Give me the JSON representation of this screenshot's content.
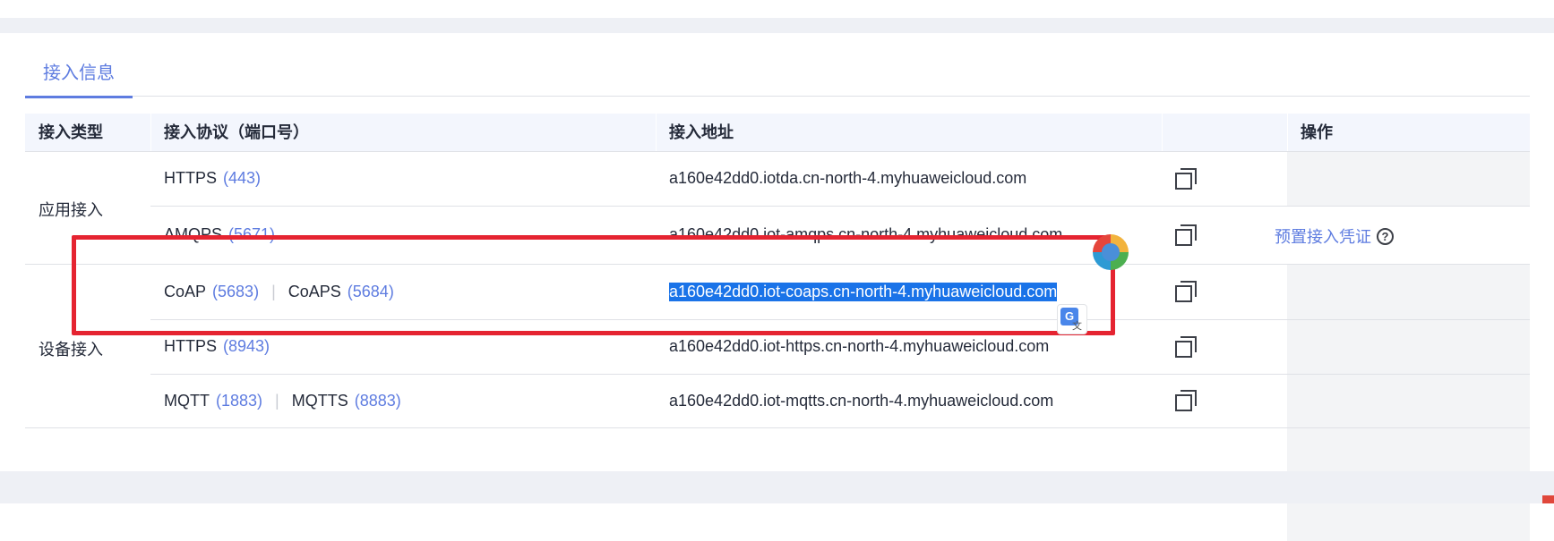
{
  "tabs": [
    {
      "label": "接入信息",
      "active": true
    }
  ],
  "table": {
    "headers": [
      "接入类型",
      "接入协议（端口号）",
      "接入地址",
      "",
      "操作"
    ],
    "groups": {
      "app": "应用接入",
      "device": "设备接入"
    },
    "rows": [
      {
        "protocols": [
          {
            "name": "HTTPS",
            "port": "(443)"
          }
        ],
        "address": "a160e42dd0.iotda.cn-north-4.myhuaweicloud.com"
      },
      {
        "protocols": [
          {
            "name": "AMQPS",
            "port": "(5671)"
          }
        ],
        "address": "a160e42dd0.iot-amqps.cn-north-4.myhuaweicloud.com"
      },
      {
        "protocols": [
          {
            "name": "CoAP",
            "port": "(5683)"
          },
          {
            "name": "CoAPS",
            "port": "(5684)"
          }
        ],
        "address": "a160e42dd0.iot-coaps.cn-north-4.myhuaweicloud.com",
        "selected": true
      },
      {
        "protocols": [
          {
            "name": "HTTPS",
            "port": "(8943)"
          }
        ],
        "address": "a160e42dd0.iot-https.cn-north-4.myhuaweicloud.com"
      },
      {
        "protocols": [
          {
            "name": "MQTT",
            "port": "(1883)"
          },
          {
            "name": "MQTTS",
            "port": "(8883)"
          }
        ],
        "address": "a160e42dd0.iot-mqtts.cn-north-4.myhuaweicloud.com"
      }
    ],
    "separator": "|",
    "operation_link": "预置接入凭证",
    "copy_icon": "copy-icon",
    "help_icon": "question-circle-icon"
  },
  "colors": {
    "accent": "#5e7ce0",
    "highlight_box": "#e52431",
    "selection": "#1a73e8"
  }
}
